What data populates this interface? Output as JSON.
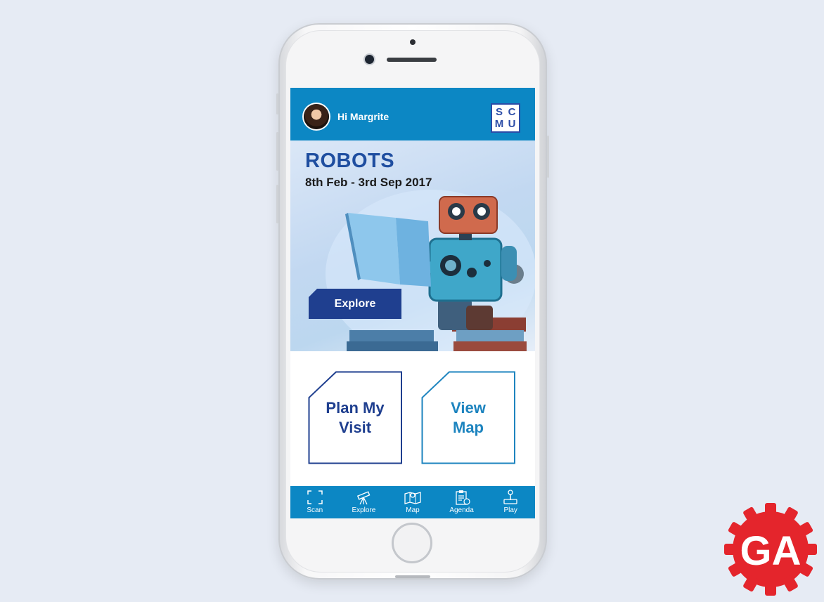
{
  "header": {
    "greeting": "Hi Margrite",
    "logo_letters": [
      "S",
      "C",
      "M",
      "U"
    ]
  },
  "hero": {
    "title": "ROBOTS",
    "dates": "8th Feb - 3rd Sep 2017",
    "cta_label": "Explore"
  },
  "tiles": {
    "plan_label": "Plan My\nVisit",
    "map_label": "View\nMap"
  },
  "tabbar": {
    "items": [
      {
        "label": "Scan",
        "icon": "scan-icon"
      },
      {
        "label": "Explore",
        "icon": "telescope-icon"
      },
      {
        "label": "Map",
        "icon": "map-icon"
      },
      {
        "label": "Agenda",
        "icon": "agenda-icon"
      },
      {
        "label": "Play",
        "icon": "joystick-icon"
      }
    ]
  },
  "badge": {
    "text": "GA"
  },
  "colors": {
    "header_blue": "#0c87c4",
    "dark_blue": "#1f3f8f",
    "light_blue": "#1d84bf",
    "badge_red": "#e4252c",
    "background": "#e6ebf4"
  }
}
